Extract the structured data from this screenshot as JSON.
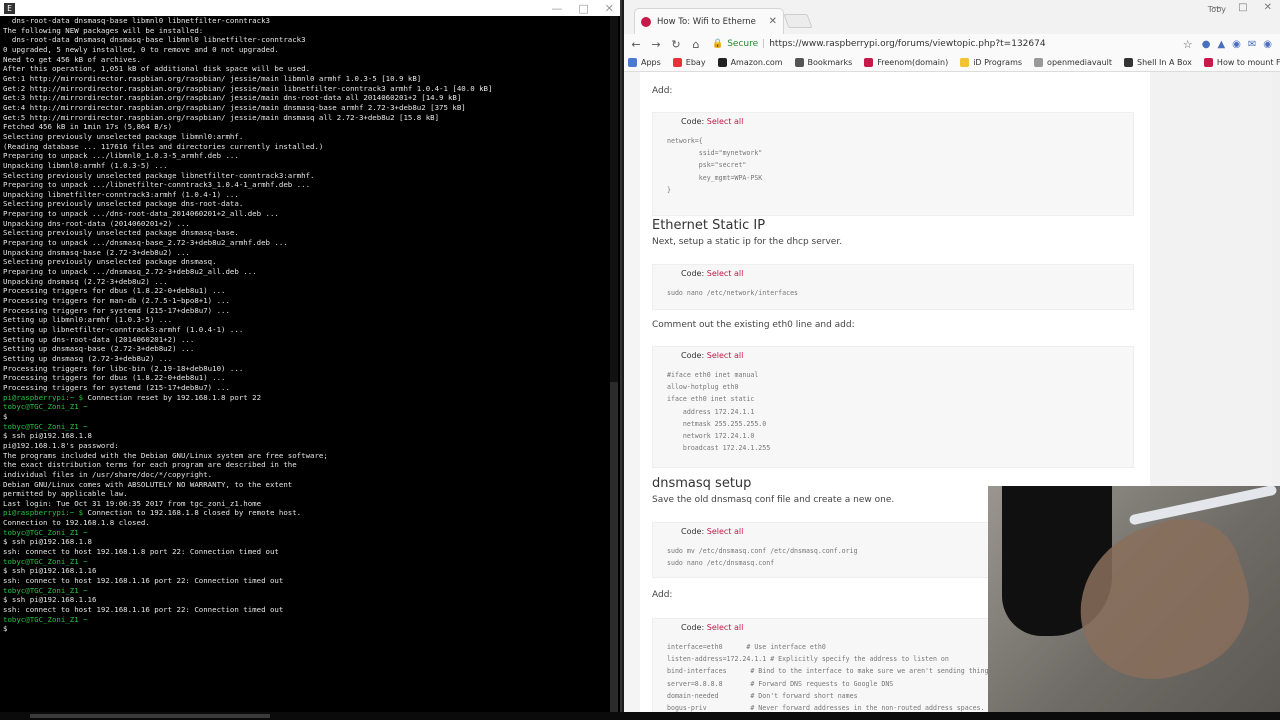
{
  "terminal": {
    "app_icon": "E",
    "lines": [
      {
        "t": "  dns-root-data dnsmasq-base libmnl0 libnetfilter-conntrack3"
      },
      {
        "t": "The following NEW packages will be installed:"
      },
      {
        "t": "  dns-root-data dnsmasq dnsmasq-base libmnl0 libnetfilter-conntrack3"
      },
      {
        "t": "0 upgraded, 5 newly installed, 0 to remove and 0 not upgraded."
      },
      {
        "t": "Need to get 456 kB of archives."
      },
      {
        "t": "After this operation, 1,051 kB of additional disk space will be used."
      },
      {
        "t": "Get:1 http://mirrordirector.raspbian.org/raspbian/ jessie/main libmnl0 armhf 1.0.3-5 [10.9 kB]"
      },
      {
        "t": "Get:2 http://mirrordirector.raspbian.org/raspbian/ jessie/main libnetfilter-conntrack3 armhf 1.0.4-1 [40.0 kB]"
      },
      {
        "t": "Get:3 http://mirrordirector.raspbian.org/raspbian/ jessie/main dns-root-data all 2014060201+2 [14.9 kB]"
      },
      {
        "t": "Get:4 http://mirrordirector.raspbian.org/raspbian/ jessie/main dnsmasq-base armhf 2.72-3+deb8u2 [375 kB]"
      },
      {
        "t": "Get:5 http://mirrordirector.raspbian.org/raspbian/ jessie/main dnsmasq all 2.72-3+deb8u2 [15.8 kB]"
      },
      {
        "t": "Fetched 456 kB in 1min 17s (5,864 B/s)"
      },
      {
        "t": "Selecting previously unselected package libmnl0:armhf."
      },
      {
        "t": "(Reading database ... 117616 files and directories currently installed.)"
      },
      {
        "t": "Preparing to unpack .../libmnl0_1.0.3-5_armhf.deb ..."
      },
      {
        "t": "Unpacking libmnl0:armhf (1.0.3-5) ..."
      },
      {
        "t": "Selecting previously unselected package libnetfilter-conntrack3:armhf."
      },
      {
        "t": "Preparing to unpack .../libnetfilter-conntrack3_1.0.4-1_armhf.deb ..."
      },
      {
        "t": "Unpacking libnetfilter-conntrack3:armhf (1.0.4-1) ..."
      },
      {
        "t": "Selecting previously unselected package dns-root-data."
      },
      {
        "t": "Preparing to unpack .../dns-root-data_2014060201+2_all.deb ..."
      },
      {
        "t": "Unpacking dns-root-data (2014060201+2) ..."
      },
      {
        "t": "Selecting previously unselected package dnsmasq-base."
      },
      {
        "t": "Preparing to unpack .../dnsmasq-base_2.72-3+deb8u2_armhf.deb ..."
      },
      {
        "t": "Unpacking dnsmasq-base (2.72-3+deb8u2) ..."
      },
      {
        "t": "Selecting previously unselected package dnsmasq."
      },
      {
        "t": "Preparing to unpack .../dnsmasq_2.72-3+deb8u2_all.deb ..."
      },
      {
        "t": "Unpacking dnsmasq (2.72-3+deb8u2) ..."
      },
      {
        "t": "Processing triggers for dbus (1.8.22-0+deb8u1) ..."
      },
      {
        "t": "Processing triggers for man-db (2.7.5-1~bpo8+1) ..."
      },
      {
        "t": "Processing triggers for systemd (215-17+deb8u7) ..."
      },
      {
        "t": "Setting up libmnl0:armhf (1.0.3-5) ..."
      },
      {
        "t": "Setting up libnetfilter-conntrack3:armhf (1.0.4-1) ..."
      },
      {
        "t": "Setting up dns-root-data (2014060201+2) ..."
      },
      {
        "t": "Setting up dnsmasq-base (2.72-3+deb8u2) ..."
      },
      {
        "t": "Setting up dnsmasq (2.72-3+deb8u2) ..."
      },
      {
        "t": "Processing triggers for libc-bin (2.19-18+deb8u10) ..."
      },
      {
        "t": "Processing triggers for dbus (1.8.22-0+deb8u1) ..."
      },
      {
        "t": "Processing triggers for systemd (215-17+deb8u7) ..."
      },
      {
        "t": "pi@raspberrypi:~ $",
        "c": " Connection reset by 192.168.1.8 port 22",
        "k": "p"
      },
      {
        "t": ""
      },
      {
        "t": "tobyc@TGC_Zoni_Z1 ~",
        "k": "p"
      },
      {
        "t": "$"
      },
      {
        "t": ""
      },
      {
        "t": "tobyc@TGC_Zoni_Z1 ~",
        "k": "p"
      },
      {
        "t": "$ ssh pi@192.168.1.8"
      },
      {
        "t": "pi@192.168.1.8's password:"
      },
      {
        "t": ""
      },
      {
        "t": "The programs included with the Debian GNU/Linux system are free software;"
      },
      {
        "t": "the exact distribution terms for each program are described in the"
      },
      {
        "t": "individual files in /usr/share/doc/*/copyright."
      },
      {
        "t": ""
      },
      {
        "t": "Debian GNU/Linux comes with ABSOLUTELY NO WARRANTY, to the extent"
      },
      {
        "t": "permitted by applicable law."
      },
      {
        "t": "Last login: Tue Oct 31 19:06:35 2017 from tgc_zoni_z1.home"
      },
      {
        "t": "pi@raspberrypi:~ $",
        "c": " Connection to 192.168.1.8 closed by remote host.",
        "k": "p"
      },
      {
        "t": "Connection to 192.168.1.8 closed."
      },
      {
        "t": ""
      },
      {
        "t": "tobyc@TGC_Zoni_Z1 ~",
        "k": "p"
      },
      {
        "t": "$ ssh pi@192.168.1.8"
      },
      {
        "t": "ssh: connect to host 192.168.1.8 port 22: Connection timed out"
      },
      {
        "t": ""
      },
      {
        "t": "tobyc@TGC_Zoni_Z1 ~",
        "k": "p"
      },
      {
        "t": "$ ssh pi@192.168.1.16"
      },
      {
        "t": "ssh: connect to host 192.168.1.16 port 22: Connection timed out"
      },
      {
        "t": ""
      },
      {
        "t": "tobyc@TGC_Zoni_Z1 ~",
        "k": "p"
      },
      {
        "t": "$ ssh pi@192.168.1.16"
      },
      {
        "t": "ssh: connect to host 192.168.1.16 port 22: Connection timed out"
      },
      {
        "t": ""
      },
      {
        "t": "tobyc@TGC_Zoni_Z1 ~",
        "k": "p"
      },
      {
        "t": "$"
      }
    ]
  },
  "browser": {
    "tab_title": "How To: Wifi to Etherne",
    "profile": "Toby",
    "secure_label": "Secure",
    "url": "https://www.raspberrypi.org/forums/viewtopic.php?t=132674",
    "bookmarks": [
      {
        "label": "Apps",
        "color": "#4a7bd0"
      },
      {
        "label": "Ebay",
        "color": "#e53238"
      },
      {
        "label": "Amazon.com",
        "color": "#222222"
      },
      {
        "label": "Bookmarks",
        "color": "#555555"
      },
      {
        "label": "Freenom(domain)",
        "color": "#c51a4a"
      },
      {
        "label": "iD Programs",
        "color": "#f1c232"
      },
      {
        "label": "openmediavault",
        "color": "#999999"
      },
      {
        "label": "Shell In A Box",
        "color": "#333333"
      },
      {
        "label": "How to mount FTP s",
        "color": "#c51a4a"
      }
    ]
  },
  "post": {
    "code_label": "Code:",
    "select_all": "Select all",
    "add_1": "Add:",
    "code_1": "network={\n        ssid=\"mynetwork\"\n        psk=\"secret\"\n        key_mgmt=WPA-PSK\n}",
    "eth_heading": "Ethernet Static IP",
    "eth_text": "Next, setup a static ip for the dhcp server.",
    "code_2": "sudo nano /etc/network/interfaces",
    "comment_text": "Comment out the existing eth0 line and add:",
    "code_3": "#iface eth0 inet manual\nallow-hotplug eth0\niface eth0 inet static\n    address 172.24.1.1\n    netmask 255.255.255.0\n    network 172.24.1.0\n    broadcast 172.24.1.255",
    "dns_heading": "dnsmasq setup",
    "dns_text": "Save the old dnsmasq conf file and create a new one.",
    "code_4": "sudo mv /etc/dnsmasq.conf /etc/dnsmasq.conf.orig\nsudo nano /etc/dnsmasq.conf",
    "add_2": "Add:",
    "code_5": "interface=eth0      # Use interface eth0\nlisten-address=172.24.1.1 # Explicitly specify the address to listen on\nbind-interfaces      # Bind to the interface to make sure we aren't sending things elsewhere\nserver=8.8.8.8       # Forward DNS requests to Google DNS\ndomain-needed        # Don't forward short names\nbogus-priv           # Never forward addresses in the non-routed address spaces."
  }
}
